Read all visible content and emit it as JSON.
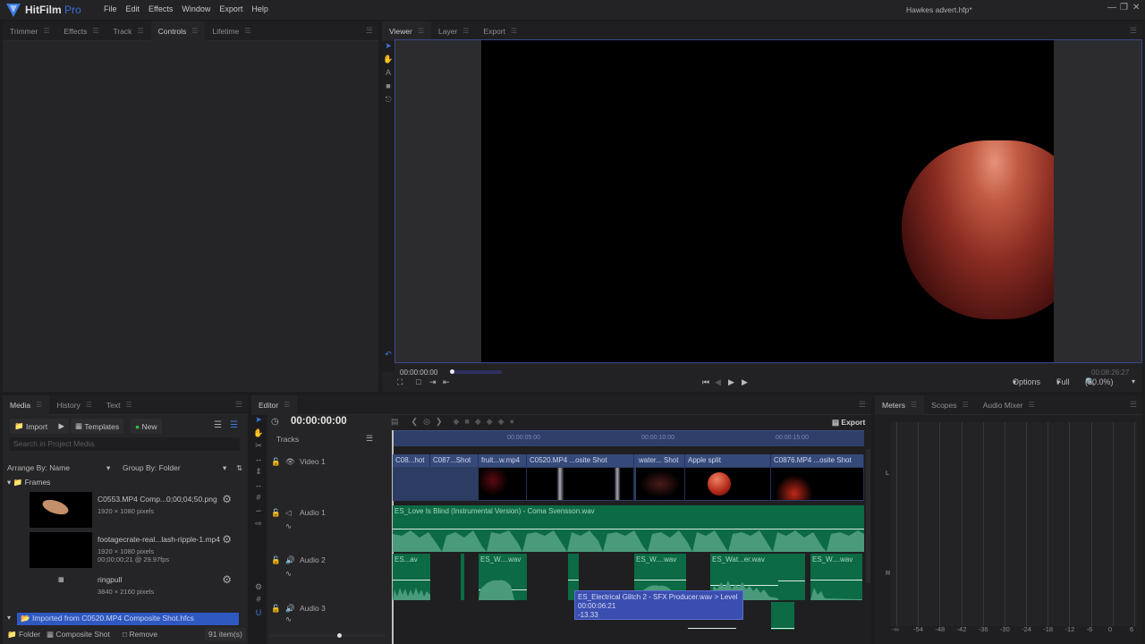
{
  "app": {
    "name": "HitFilm",
    "edition": "Pro",
    "document_title": "Hawkes advert.hfp*",
    "menu": [
      "File",
      "Edit",
      "Effects",
      "Window",
      "Export",
      "Help"
    ]
  },
  "left_panel": {
    "tabs": [
      "Trimmer",
      "Effects",
      "Track",
      "Controls",
      "Lifetime"
    ],
    "active_tab": "Controls"
  },
  "viewer": {
    "tabs": [
      "Viewer",
      "Layer",
      "Export"
    ],
    "active_tab": "Viewer",
    "current_time": "00:00:00:00",
    "end_time": "00:08:26:27",
    "options_label": "Options",
    "quality": "Full",
    "zoom": "(50.0%)",
    "playhead_fraction": 0.0
  },
  "media": {
    "tabs": [
      "Media",
      "History",
      "Text"
    ],
    "active_tab": "Media",
    "import_label": "Import",
    "templates_label": "Templates",
    "new_label": "New",
    "search_placeholder": "Search in Project Media",
    "arrange_by": "Arrange By: Name",
    "group_by": "Group By: Folder",
    "folder_name": "Frames",
    "items": [
      {
        "name": "C0553.MP4 Comp...0;00;04;50.png",
        "details": [
          "1920 × 1080 pixels"
        ]
      },
      {
        "name": "footagecrate-real...lash-ripple-1.mp4",
        "details": [
          "1920 × 1080 pixels",
          "00;00;00;21 @ 29.97fps"
        ]
      },
      {
        "name": "ringpull",
        "details": [
          "3840 × 2160 pixels"
        ]
      }
    ],
    "selected_folder": "Imported from C0520.MP4 Composite Shot.hfcs",
    "footer": {
      "folder_label": "Folder",
      "composite_label": "Composite Shot",
      "remove_label": "Remove",
      "count": "91 item(s)"
    }
  },
  "editor": {
    "tab": "Editor",
    "current_time": "00:00:00:00",
    "tracks_label": "Tracks",
    "export_label": "Export",
    "ruler_labels": [
      "00:00:05:00",
      "00:00:10:00",
      "00:00:15:00"
    ],
    "tracks": [
      {
        "name": "Video 1",
        "type": "video"
      },
      {
        "name": "Audio 1",
        "type": "audio"
      },
      {
        "name": "Audio 2",
        "type": "audio"
      },
      {
        "name": "Audio 3",
        "type": "audio"
      }
    ],
    "video_clips": [
      "C08...hot",
      "C087...Shot",
      "fruit...w.mp4",
      "C0520.MP4 ...osite Shot",
      "",
      "water... Shot",
      "Apple split",
      "C0876.MP4 ...osite Shot"
    ],
    "audio1_clip": "ES_Love Is Blind (Instrumental Version) - Coma Svensson.wav",
    "audio2_clips": [
      "ES...av",
      "ES_W....wav",
      "ES_W....wav",
      "ES_Wat...er.wav",
      "ES_W....wav"
    ],
    "tooltip": {
      "line1": "ES_Electrical Glitch 2 - SFX Producer.wav > Level",
      "line2": "00:00:06:21",
      "line3": "-13.33"
    }
  },
  "meters": {
    "tabs": [
      "Meters",
      "Scopes",
      "Audio Mixer"
    ],
    "active_tab": "Meters",
    "channels": [
      "L",
      "R"
    ],
    "scale": [
      "-∞",
      "-54",
      "-48",
      "-42",
      "-36",
      "-30",
      "-24",
      "-18",
      "-12",
      "-6",
      "0",
      "6"
    ]
  }
}
